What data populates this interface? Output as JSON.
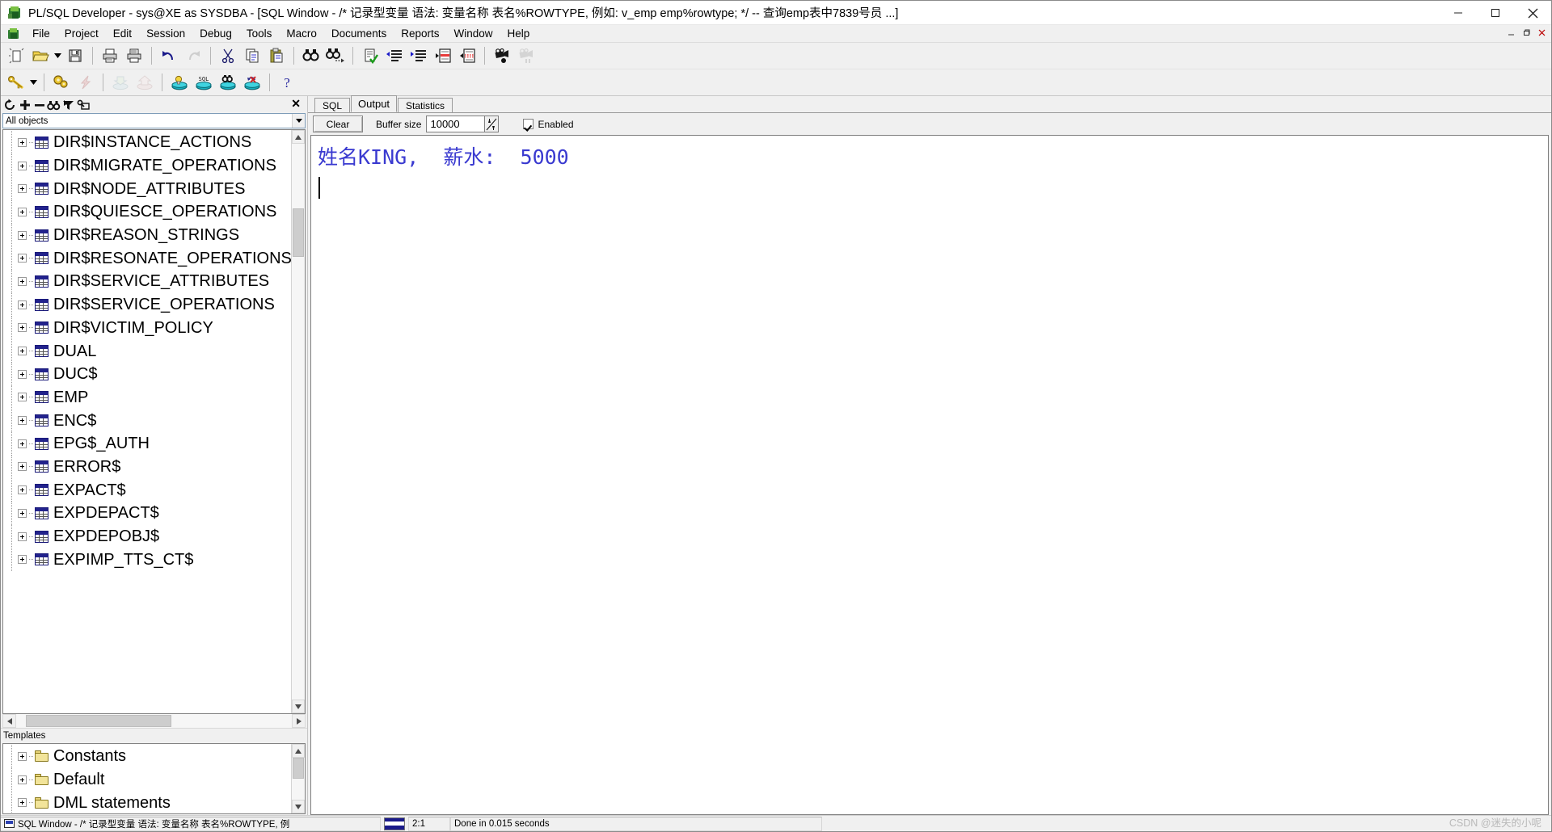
{
  "window": {
    "title": "PL/SQL Developer - sys@XE as SYSDBA - [SQL Window - /* 记录型变量 语法:  变量名称 表名%ROWTYPE,  例如:  v_emp emp%rowtype; */ -- 查询emp表中7839号员 ...]",
    "minimize_label": "─",
    "maximize_label": "❐",
    "close_label": "✕",
    "mdi_restore_label": "–",
    "mdi_maximize_label": "❐",
    "mdi_close_label": "✕"
  },
  "menu": {
    "items": [
      {
        "label": "File"
      },
      {
        "label": "Project"
      },
      {
        "label": "Edit"
      },
      {
        "label": "Session"
      },
      {
        "label": "Debug"
      },
      {
        "label": "Tools"
      },
      {
        "label": "Macro"
      },
      {
        "label": "Documents"
      },
      {
        "label": "Reports"
      },
      {
        "label": "Window"
      },
      {
        "label": "Help"
      }
    ]
  },
  "toolbar_main": {
    "buttons": [
      {
        "icon": "new-document-icon",
        "name": "new-button"
      },
      {
        "icon": "open-folder-icon",
        "name": "open-button"
      },
      {
        "icon": "dropdown-arrow-icon",
        "name": "open-dropdown-button"
      },
      {
        "icon": "save-floppy-icon",
        "name": "save-button"
      },
      {
        "icon": "print-icon",
        "name": "print-button"
      },
      {
        "icon": "print-preview-icon",
        "name": "print-preview-button"
      },
      {
        "icon": "undo-arrow-icon",
        "name": "undo-button"
      },
      {
        "icon": "redo-arrow-icon",
        "name": "redo-button"
      },
      {
        "icon": "scissors-cut-icon",
        "name": "cut-button"
      },
      {
        "icon": "copy-pages-icon",
        "name": "copy-button"
      },
      {
        "icon": "clipboard-paste-icon",
        "name": "paste-button"
      },
      {
        "icon": "binoculars-find-icon",
        "name": "find-button"
      },
      {
        "icon": "binoculars-find-next-icon",
        "name": "find-next-button"
      },
      {
        "icon": "document-check-icon",
        "name": "syntax-check-button"
      },
      {
        "icon": "indent-right-icon",
        "name": "indent-button"
      },
      {
        "icon": "indent-left-icon",
        "name": "outdent-button"
      },
      {
        "icon": "comment-document-icon",
        "name": "comment-button"
      },
      {
        "icon": "uncomment-document-icon",
        "name": "uncomment-button"
      },
      {
        "icon": "record-macro-icon",
        "name": "record-macro-button"
      },
      {
        "icon": "play-macro-icon",
        "name": "play-macro-button"
      }
    ]
  },
  "toolbar_second": {
    "buttons": [
      {
        "icon": "key-icon",
        "name": "explain-plan-button"
      },
      {
        "icon": "dropdown-arrow-icon",
        "name": "explain-dropdown-button"
      },
      {
        "icon": "gears-icon",
        "name": "execute-button"
      },
      {
        "icon": "lightning-break-icon",
        "name": "break-button"
      },
      {
        "icon": "import-down-icon",
        "name": "import-button"
      },
      {
        "icon": "export-up-icon",
        "name": "export-button"
      },
      {
        "icon": "db-bulb-icon",
        "name": "session-info-button"
      },
      {
        "icon": "db-sql-icon",
        "name": "sql-button"
      },
      {
        "icon": "db-find-icon",
        "name": "db-find-button"
      },
      {
        "icon": "db-rollback-icon",
        "name": "rollback-button"
      },
      {
        "icon": "help-question-icon",
        "name": "help-button"
      }
    ]
  },
  "browser": {
    "toolbar_buttons": [
      {
        "icon": "refresh-icon",
        "name": "refresh-button"
      },
      {
        "icon": "plus-icon",
        "name": "expand-button"
      },
      {
        "icon": "minus-icon",
        "name": "collapse-button"
      },
      {
        "icon": "binoculars-icon",
        "name": "browser-find-button"
      },
      {
        "icon": "filter-icon",
        "name": "filter-button"
      },
      {
        "icon": "folder-key-icon",
        "name": "browser-folder-button"
      }
    ],
    "close_label": "✕",
    "filter": {
      "value": "All objects",
      "arrow": "▼"
    },
    "tree_items": [
      {
        "label": "DIR$INSTANCE_ACTIONS",
        "icon": "table-icon"
      },
      {
        "label": "DIR$MIGRATE_OPERATIONS",
        "icon": "table-icon"
      },
      {
        "label": "DIR$NODE_ATTRIBUTES",
        "icon": "table-icon"
      },
      {
        "label": "DIR$QUIESCE_OPERATIONS",
        "icon": "table-icon"
      },
      {
        "label": "DIR$REASON_STRINGS",
        "icon": "table-icon"
      },
      {
        "label": "DIR$RESONATE_OPERATIONS",
        "icon": "table-icon"
      },
      {
        "label": "DIR$SERVICE_ATTRIBUTES",
        "icon": "table-icon"
      },
      {
        "label": "DIR$SERVICE_OPERATIONS",
        "icon": "table-icon"
      },
      {
        "label": "DIR$VICTIM_POLICY",
        "icon": "table-icon"
      },
      {
        "label": "DUAL",
        "icon": "table-icon"
      },
      {
        "label": "DUC$",
        "icon": "table-icon"
      },
      {
        "label": "EMP",
        "icon": "table-icon"
      },
      {
        "label": "ENC$",
        "icon": "table-icon"
      },
      {
        "label": "EPG$_AUTH",
        "icon": "table-icon"
      },
      {
        "label": "ERROR$",
        "icon": "table-icon"
      },
      {
        "label": "EXPACT$",
        "icon": "table-icon"
      },
      {
        "label": "EXPDEPACT$",
        "icon": "table-icon"
      },
      {
        "label": "EXPDEPOBJ$",
        "icon": "table-icon"
      },
      {
        "label": "EXPIMP_TTS_CT$",
        "icon": "table-icon"
      }
    ],
    "scroll_up": "▲",
    "scroll_down": "▼",
    "scroll_left": "‹",
    "scroll_right": "›"
  },
  "templates": {
    "header": "Templates",
    "items": [
      {
        "label": "Constants",
        "icon": "folder-icon"
      },
      {
        "label": "Default",
        "icon": "folder-icon"
      },
      {
        "label": "DML statements",
        "icon": "folder-icon"
      }
    ]
  },
  "editor": {
    "tabs": [
      {
        "label": "SQL",
        "active": false
      },
      {
        "label": "Output",
        "active": true
      },
      {
        "label": "Statistics",
        "active": false
      }
    ],
    "output_toolbar": {
      "clear_label": "Clear",
      "buffer_label": "Buffer size",
      "buffer_value": "10000",
      "enabled_label": "Enabled"
    },
    "output_text": "姓名KING,  薪水:  5000"
  },
  "statusbar": {
    "document": "SQL Window - /* 记录型变量 语法:  变量名称 表名%ROWTYPE,  例",
    "position": "2:1",
    "message": "Done in 0.015 seconds",
    "watermark": "CSDN @迷失的小呢"
  },
  "colors": {
    "output_text": "#3a3ad0",
    "window_bg": "#f0f0f0",
    "panel_border": "#828282",
    "table_icon_header": "#22228c"
  }
}
